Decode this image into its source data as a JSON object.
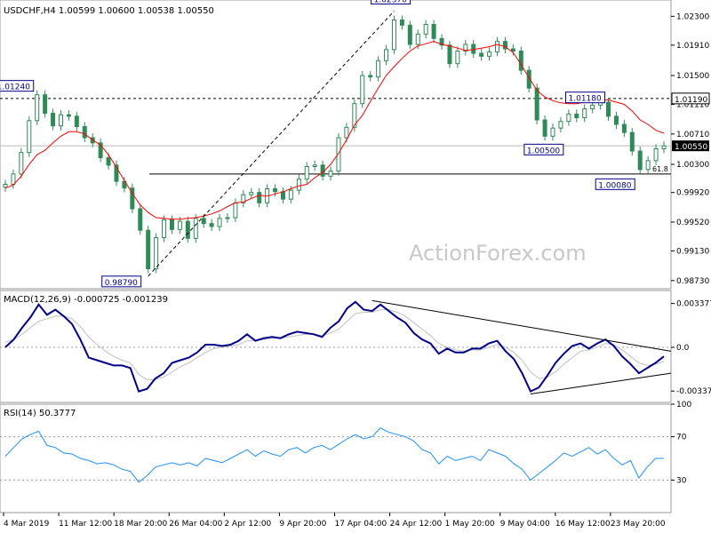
{
  "chart_data": [
    {
      "type": "candlestick",
      "title": "USDCHF,H4  1.00599 1.00600 1.00538 1.00550",
      "y_ticks": [
        "1.02300",
        "1.01910",
        "1.01500",
        "1.01110",
        "1.00710",
        "1.00300",
        "0.99920",
        "0.99520",
        "0.99130",
        "0.98730"
      ],
      "ylim": [
        0.9862,
        1.0252
      ],
      "current_price": "1.00550",
      "resistance_level": "1.01190",
      "fib_label": "61.8",
      "fib_level": 1.0017,
      "callouts": [
        {
          "label": "1.02370",
          "value": 1.0237
        },
        {
          "label": "0.98790",
          "value": 0.9879
        },
        {
          "label": "1.00500",
          "value": 1.005
        },
        {
          "label": "1.00080",
          "value": 1.0008
        },
        {
          "label": "1.01180",
          "value": 1.0118
        },
        {
          "label": "1.01240",
          "value": 1.0124
        }
      ],
      "closes": [
        1.0003,
        1.0017,
        1.0046,
        1.0089,
        1.0124,
        1.0099,
        1.0082,
        1.0097,
        1.0095,
        1.0081,
        1.0066,
        1.0059,
        1.0039,
        1.0029,
        1.0007,
        0.9998,
        0.997,
        0.9941,
        0.9889,
        0.9931,
        0.9955,
        0.9942,
        0.9953,
        0.993,
        0.9957,
        0.995,
        0.9946,
        0.9957,
        0.9958,
        0.9978,
        0.9989,
        0.9992,
        0.9978,
        0.9997,
        0.9993,
        0.9983,
        0.9995,
        1.001,
        1.0027,
        1.0029,
        1.0014,
        1.0021,
        1.0066,
        1.008,
        1.0112,
        1.015,
        1.0148,
        1.017,
        1.0185,
        1.0225,
        1.0218,
        1.0192,
        1.0206,
        1.0219,
        1.02,
        1.0191,
        1.0166,
        1.0183,
        1.0192,
        1.018,
        1.0176,
        1.0182,
        1.0196,
        1.0186,
        1.0183,
        1.0157,
        1.0133,
        1.009,
        1.0068,
        1.0079,
        1.0088,
        1.0098,
        1.0093,
        1.0105,
        1.011,
        1.0114,
        1.0095,
        1.0084,
        1.0073,
        1.0048,
        1.0023,
        1.0035,
        1.0051,
        1.0055
      ],
      "ma": [
        0.9998,
        1.0002,
        1.0014,
        1.003,
        1.0043,
        1.0049,
        1.0059,
        1.0068,
        1.0074,
        1.0074,
        1.0071,
        1.0063,
        1.0056,
        1.0043,
        1.0026,
        1.0008,
        0.9991,
        0.9975,
        0.9965,
        0.9958,
        0.9957,
        0.9956,
        0.9956,
        0.9957,
        0.9958,
        0.996,
        0.9963,
        0.9967,
        0.9973,
        0.9978,
        0.9979,
        0.9984,
        0.9988,
        0.9987,
        0.999,
        0.9993,
        0.9997,
        1.0001,
        1.0003,
        1.0012,
        1.0019,
        1.003,
        1.0045,
        1.0063,
        1.0083,
        1.0096,
        1.0115,
        1.0133,
        1.015,
        1.0162,
        1.0173,
        1.0183,
        1.019,
        1.0193,
        1.0196,
        1.0192,
        1.019,
        1.0187,
        1.0184,
        1.0185,
        1.0187,
        1.0189,
        1.0192,
        1.0189,
        1.0181,
        1.0165,
        1.0147,
        1.013,
        1.0121,
        1.0116,
        1.0113,
        1.0112,
        1.0112,
        1.0114,
        1.0116,
        1.0117,
        1.0117,
        1.0114,
        1.0111,
        1.0102,
        1.009,
        1.0084,
        1.0076,
        1.0072
      ]
    },
    {
      "type": "line",
      "title": "MACD(12,26,9) -0.000725 -0.001239",
      "y_ticks": [
        "0.003377",
        "0.0",
        "-0.003373"
      ],
      "ylim": [
        -0.00425,
        0.00438
      ],
      "macd": [
        0.0,
        0.0006,
        0.0015,
        0.0023,
        0.0033,
        0.0025,
        0.0029,
        0.0024,
        0.0018,
        0.0006,
        -0.0008,
        -0.001,
        -0.0012,
        -0.0014,
        -0.0014,
        -0.0016,
        -0.0034,
        -0.0032,
        -0.0024,
        -0.002,
        -0.0012,
        -0.001,
        -0.0008,
        -0.0004,
        0.0002,
        0.0002,
        0.0001,
        0.0002,
        0.0005,
        0.001,
        0.0005,
        0.0007,
        0.0008,
        0.0007,
        0.001,
        0.0012,
        0.0011,
        0.001,
        0.0008,
        0.0015,
        0.002,
        0.003,
        0.0035,
        0.0029,
        0.0028,
        0.0033,
        0.0028,
        0.0023,
        0.0019,
        0.0011,
        0.0006,
        0.0003,
        -0.0005,
        -0.0001,
        -0.0004,
        -0.0004,
        -0.0001,
        -0.0001,
        0.0003,
        0.0005,
        -0.0003,
        -0.0009,
        -0.002,
        -0.0034,
        -0.0031,
        -0.0022,
        -0.0012,
        -0.0005,
        0.0001,
        0.0003,
        -0.0001,
        0.0003,
        0.0006,
        0.0001,
        -0.0007,
        -0.0013,
        -0.002,
        -0.0016,
        -0.0012,
        -0.0007
      ],
      "signal": [
        0.0004,
        0.0006,
        0.001,
        0.0015,
        0.002,
        0.0022,
        0.0024,
        0.0024,
        0.0022,
        0.0016,
        0.0008,
        0.0002,
        -0.0003,
        -0.0007,
        -0.001,
        -0.0012,
        -0.0021,
        -0.0025,
        -0.0025,
        -0.0023,
        -0.0019,
        -0.0015,
        -0.0012,
        -0.0008,
        -0.0004,
        -0.0001,
        0.0,
        0.0001,
        0.0002,
        0.0005,
        0.0005,
        0.0006,
        0.0007,
        0.0007,
        0.0008,
        0.0009,
        0.001,
        0.001,
        0.0009,
        0.0011,
        0.0014,
        0.002,
        0.0026,
        0.0027,
        0.0027,
        0.0029,
        0.0029,
        0.0027,
        0.0024,
        0.0019,
        0.0014,
        0.0009,
        0.0003,
        0.0,
        -0.0002,
        -0.0003,
        -0.0002,
        -0.0002,
        0.0,
        0.0002,
        0.0,
        -0.0004,
        -0.001,
        -0.0019,
        -0.0024,
        -0.0023,
        -0.0019,
        -0.0013,
        -0.0008,
        -0.0003,
        -0.0002,
        0.0,
        0.0003,
        0.0002,
        -0.0002,
        -0.0007,
        -0.0012,
        -0.0014,
        -0.0013,
        -0.0011
      ]
    },
    {
      "type": "line",
      "title": "RSI(14) 50.3777",
      "y_ticks": [
        "100",
        "70",
        "30"
      ],
      "ylim": [
        0,
        100
      ],
      "values": [
        52,
        60,
        68,
        72,
        75,
        62,
        60,
        55,
        54,
        50,
        48,
        45,
        46,
        44,
        40,
        38,
        28,
        34,
        42,
        44,
        46,
        44,
        46,
        43,
        50,
        48,
        46,
        50,
        54,
        58,
        52,
        57,
        54,
        52,
        58,
        60,
        55,
        60,
        62,
        58,
        63,
        68,
        72,
        68,
        70,
        78,
        74,
        72,
        70,
        66,
        58,
        55,
        45,
        52,
        48,
        50,
        52,
        48,
        58,
        55,
        52,
        45,
        40,
        30,
        36,
        42,
        48,
        55,
        52,
        56,
        60,
        54,
        58,
        50,
        44,
        48,
        32,
        42,
        50,
        50
      ],
      "x_tick_labels": [
        "4 Mar 2019",
        "11 Mar 12:00",
        "18 Mar 20:00",
        "26 Mar 04:00",
        "2 Apr 12:00",
        "9 Apr 20:00",
        "17 Apr 04:00",
        "24 Apr 12:00",
        "1 May 20:00",
        "9 May 04:00",
        "16 May 12:00",
        "23 May 20:00"
      ]
    }
  ],
  "watermark": "ActionForex.com",
  "colors": {
    "candle": "#2e8b57",
    "ma": "#ff0000",
    "macd": "#00008b",
    "signal": "#c0c0c0",
    "rsi": "#1e90ff",
    "price_box_fill": "#ffffff",
    "callout_border": "#00008b",
    "current_box_fill": "#000000"
  }
}
